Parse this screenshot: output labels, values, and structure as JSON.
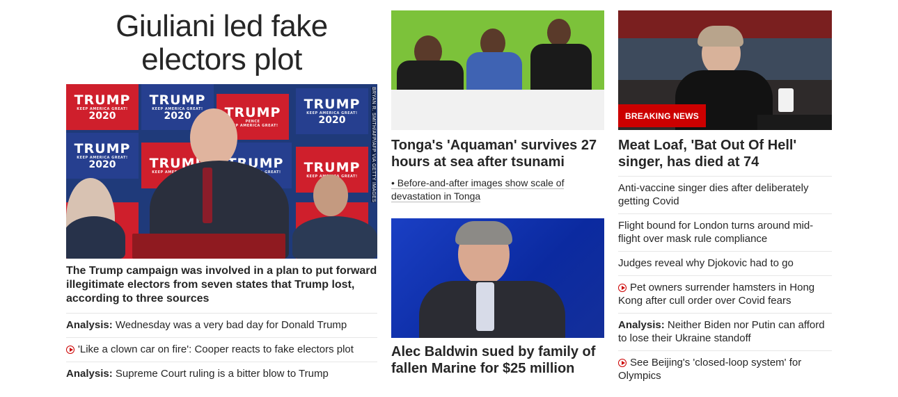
{
  "col1": {
    "headline_line1": "Giuliani led fake",
    "headline_line2": "electors plot",
    "image_credit": "BRYAN R. SMITH/AFP/AFP VIA GETTY IMAGES",
    "poster_word": "TRUMP",
    "poster_tag": "KEEP AMERICA GREAT!",
    "poster_year": "2020",
    "poster_pence": "PENCE",
    "lead_text": "The Trump campaign was involved in a plan to put forward illegitimate electors from seven states that Trump lost, according to three sources",
    "items": [
      {
        "prefix": "Analysis:",
        "text": " Wednesday was a very bad day for Donald Trump"
      },
      {
        "text": "'Like a clown car on fire': Cooper reacts to fake electors plot"
      },
      {
        "prefix": "Analysis:",
        "text": " Supreme Court ruling is a bitter blow to Trump"
      }
    ]
  },
  "col2": {
    "story1_title": "Tonga's 'Aquaman' survives 27 hours at sea after tsunami",
    "story1_sub": "• Before-and-after images show scale of devastation in Tonga",
    "story2_title": "Alec Baldwin sued by family of fallen Marine for $25 million"
  },
  "col3": {
    "breaking_label": "BREAKING NEWS",
    "title": "Meat Loaf, 'Bat Out Of Hell' singer, has died at 74",
    "items": [
      {
        "text": "Anti-vaccine singer dies after deliberately getting Covid"
      },
      {
        "text": "Flight bound for London turns around mid-flight over mask rule compliance"
      },
      {
        "text": "Judges reveal why Djokovic had to go"
      },
      {
        "text": "Pet owners surrender hamsters in Hong Kong after cull order over Covid fears"
      },
      {
        "prefix": "Analysis:",
        "text": " Neither Biden nor Putin can afford to lose their Ukraine standoff"
      },
      {
        "text": "See Beijing's 'closed-loop system' for Olympics"
      }
    ]
  },
  "colors": {
    "accent_red": "#cc0000",
    "text": "#262626",
    "divider": "#e6e6e6"
  }
}
